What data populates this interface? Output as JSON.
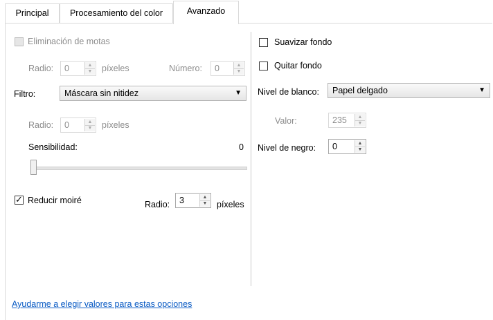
{
  "tabs": [
    {
      "label": "Principal"
    },
    {
      "label": "Procesamiento del color"
    },
    {
      "label": "Avanzado"
    }
  ],
  "left": {
    "speckle": {
      "label": "Eliminación de motas",
      "checked": false,
      "enabled": false
    },
    "radius1": {
      "label": "Radio:",
      "value": "0",
      "unit": "píxeles"
    },
    "number": {
      "label": "Número:",
      "value": "0"
    },
    "filter": {
      "label": "Filtro:",
      "value": "Máscara sin nitidez"
    },
    "radius2": {
      "label": "Radio:",
      "value": "0",
      "unit": "píxeles"
    },
    "sensitivity": {
      "label": "Sensibilidad:",
      "value": "0",
      "level": 0
    },
    "moire": {
      "label": "Reducir moiré",
      "checked": true
    },
    "moire_radius": {
      "label": "Radio:",
      "value": "3",
      "unit": "píxeles"
    }
  },
  "right": {
    "smooth_bg": {
      "label": "Suavizar fondo",
      "checked": false
    },
    "remove_bg": {
      "label": "Quitar fondo",
      "checked": false
    },
    "white_level": {
      "label": "Nivel de blanco:",
      "value": "Papel delgado"
    },
    "value": {
      "label": "Valor:",
      "value": "235"
    },
    "black_level": {
      "label": "Nivel de negro:",
      "value": "0"
    }
  },
  "help_link": "Ayudarme a elegir valores para estas opciones",
  "icons": {
    "arrow_up": "▲",
    "arrow_down": "▼",
    "dropdown": "▼",
    "check": "✓"
  }
}
